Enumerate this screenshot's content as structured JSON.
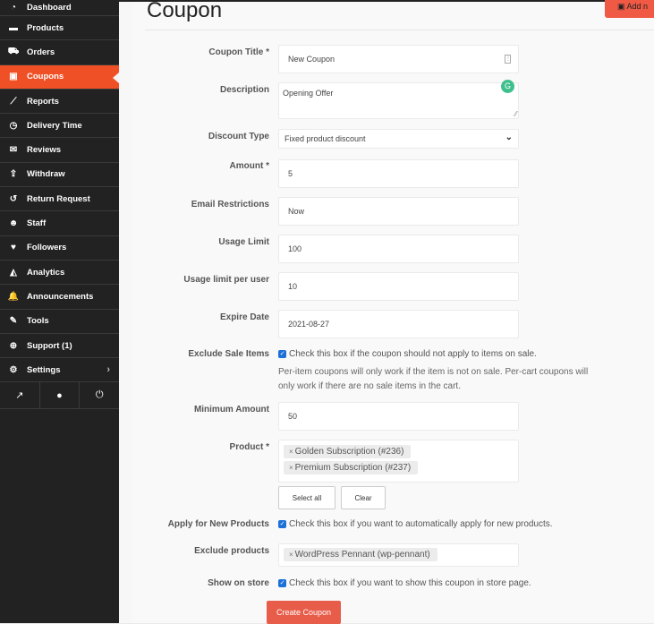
{
  "sidebar": {
    "items": [
      {
        "label": "Dashboard",
        "icon": "dashboard-icon",
        "glyph": "◔"
      },
      {
        "label": "Products",
        "icon": "briefcase-icon",
        "glyph": "▬"
      },
      {
        "label": "Orders",
        "icon": "cart-icon",
        "glyph": "⛟"
      },
      {
        "label": "Coupons",
        "icon": "gift-icon",
        "glyph": "▣",
        "active": true
      },
      {
        "label": "Reports",
        "icon": "line-chart-icon",
        "glyph": "⟋"
      },
      {
        "label": "Delivery Time",
        "icon": "clock-icon",
        "glyph": "◷"
      },
      {
        "label": "Reviews",
        "icon": "comments-icon",
        "glyph": "✉"
      },
      {
        "label": "Withdraw",
        "icon": "upload-icon",
        "glyph": "⇪"
      },
      {
        "label": "Return Request",
        "icon": "undo-icon",
        "glyph": "↺"
      },
      {
        "label": "Staff",
        "icon": "users-icon",
        "glyph": "☻"
      },
      {
        "label": "Followers",
        "icon": "heart-icon",
        "glyph": "♥"
      },
      {
        "label": "Analytics",
        "icon": "area-chart-icon",
        "glyph": "◭"
      },
      {
        "label": "Announcements",
        "icon": "bell-icon",
        "glyph": "🔔"
      },
      {
        "label": "Tools",
        "icon": "wrench-icon",
        "glyph": "✎"
      },
      {
        "label": "Support (1)",
        "icon": "life-ring-icon",
        "glyph": "⊕"
      },
      {
        "label": "Settings",
        "icon": "gear-icon",
        "glyph": "⚙"
      }
    ],
    "settings_chevron": "›",
    "bottom": {
      "external": "↗",
      "user": "●",
      "power": "⏻"
    }
  },
  "header": {
    "title": "Coupon",
    "add_button_label": "Add n",
    "add_button_icon": "▣"
  },
  "form": {
    "coupon_title": {
      "label": "Coupon Title *",
      "value": "New Coupon"
    },
    "description": {
      "label": "Description",
      "value": "Opening Offer"
    },
    "discount_type": {
      "label": "Discount Type",
      "value": "Fixed product discount"
    },
    "amount": {
      "label": "Amount *",
      "value": "5"
    },
    "email_restrictions": {
      "label": "Email Restrictions",
      "value": "Now"
    },
    "usage_limit": {
      "label": "Usage Limit",
      "value": "100"
    },
    "usage_limit_per_user": {
      "label": "Usage limit per user",
      "value": "10"
    },
    "expire_date": {
      "label": "Expire Date",
      "value": "2021-08-27"
    },
    "exclude_sale_items": {
      "label": "Exclude Sale Items",
      "checked": true,
      "text": "Check this box if the coupon should not apply to items on sale.",
      "help_line1": "Per-item coupons will only work if the item is not on sale. Per-cart coupons will",
      "help_line2": "only work if there are no sale items in the cart."
    },
    "minimum_amount": {
      "label": "Minimum Amount",
      "value": "50"
    },
    "product": {
      "label": "Product *",
      "tags": [
        "Golden Subscription (#236)",
        "Premium Subscription (#237)"
      ],
      "select_all": "Select all",
      "clear": "Clear"
    },
    "apply_new_products": {
      "label": "Apply for New Products",
      "checked": true,
      "text": "Check this box if you want to automatically apply for new products."
    },
    "exclude_products": {
      "label": "Exclude products",
      "tags": [
        "WordPress Pennant (wp-pennant)"
      ]
    },
    "show_on_store": {
      "label": "Show on store",
      "checked": true,
      "text": "Check this box if you want to show this coupon in store page."
    },
    "submit_label": "Create Coupon"
  },
  "colors": {
    "accent": "#f05025",
    "button": "#e85c4a",
    "sidebar_bg": "#222222",
    "checkbox": "#1c70d8"
  }
}
